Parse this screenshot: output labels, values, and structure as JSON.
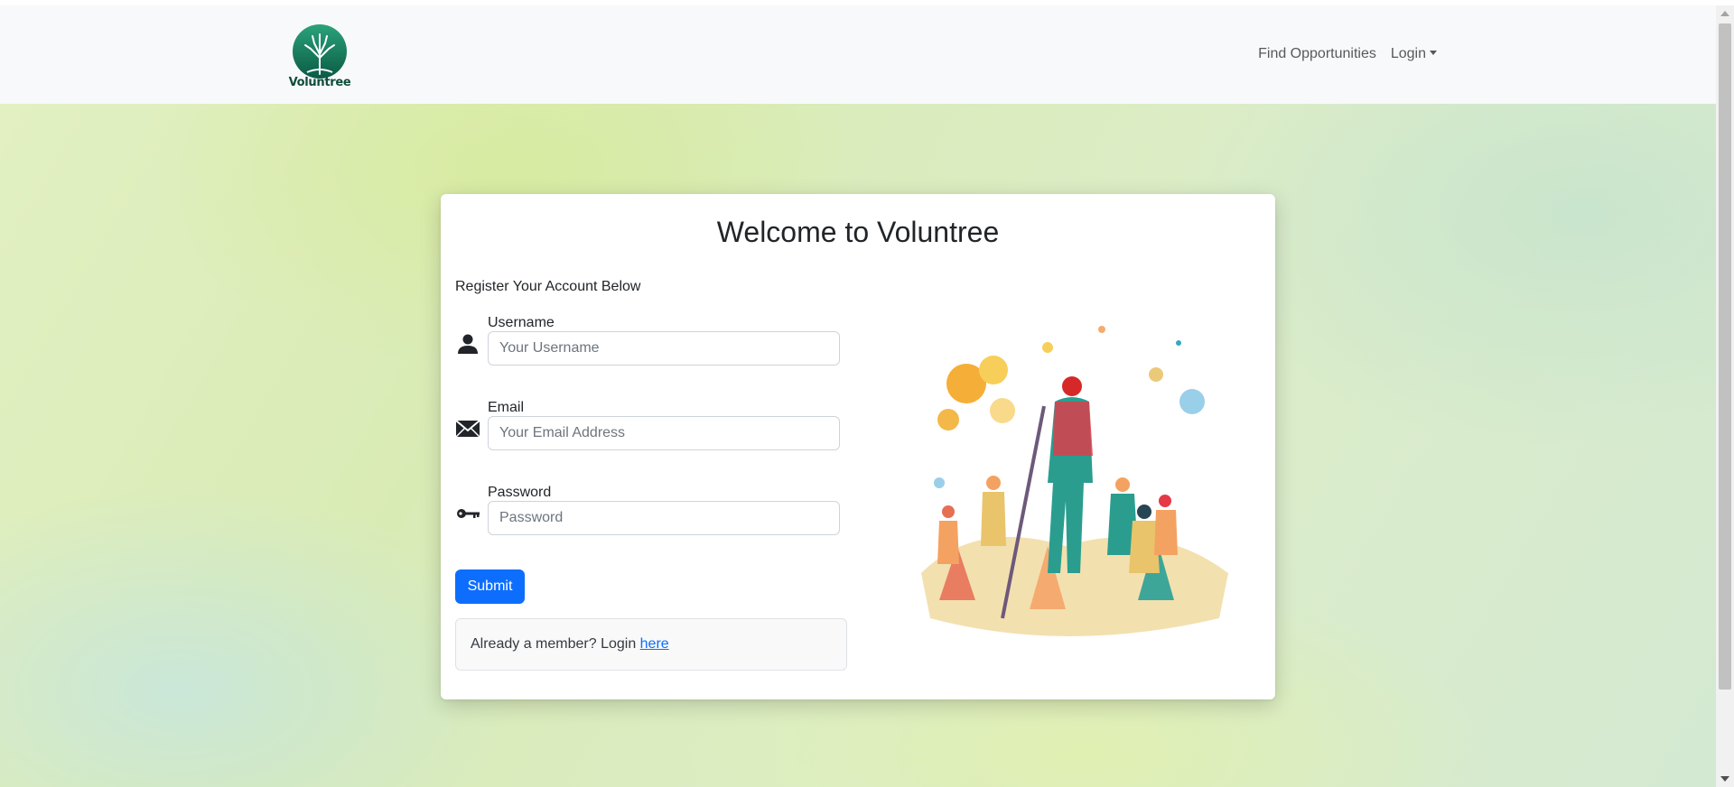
{
  "brand": {
    "name": "Voluntree",
    "color": "#0f4c3a"
  },
  "nav": {
    "items": [
      {
        "label": "Find Opportunities"
      },
      {
        "label": "Login"
      }
    ]
  },
  "card": {
    "title": "Welcome to Voluntree",
    "subtitle": "Register Your Account Below",
    "fields": {
      "username": {
        "label": "Username",
        "placeholder": "Your Username",
        "icon": "person-icon",
        "value": ""
      },
      "email": {
        "label": "Email",
        "placeholder": "Your Email Address",
        "icon": "envelope-icon",
        "value": ""
      },
      "password": {
        "label": "Password",
        "placeholder": "Password",
        "icon": "key-icon",
        "value": ""
      }
    },
    "submit_label": "Submit",
    "member_prompt": "Already a member? Login ",
    "member_link": "here"
  },
  "colors": {
    "accent": "#0d6efd",
    "navbar_bg": "#f8f9fa"
  }
}
